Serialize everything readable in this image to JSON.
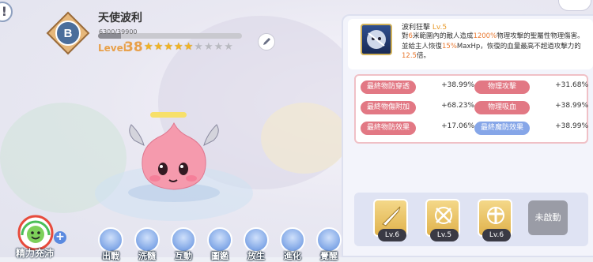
{
  "pet": {
    "rank": "B",
    "name": "天使波利",
    "exp_text": "6300/39900",
    "exp_fraction": 0.16,
    "level_label": "Level",
    "level_value": "38",
    "stars_filled": 5,
    "stars_total": 9
  },
  "skill": {
    "name": "波利狂擊",
    "level": "Lv.5",
    "desc_1": "對",
    "desc_2": "6",
    "desc_3": "米範圍內的敵人造成",
    "desc_4": "1200%",
    "desc_5": "物理攻擊的聖屬性物理傷害。並給主人恢復",
    "desc_6": "15%",
    "desc_7": "MaxHp，恢復的血量最高不超過攻擊力的",
    "desc_8": "12.5",
    "desc_9": "倍。"
  },
  "stats": [
    {
      "label": "最終物防穿透",
      "value": "+38.99%"
    },
    {
      "label": "最終物傷附加",
      "value": "+68.23%"
    },
    {
      "label": "最終物防效果",
      "value": "+17.06%"
    },
    {
      "label": "物理攻擊",
      "value": "+31.68%"
    },
    {
      "label": "物理吸血",
      "value": "+38.99%"
    },
    {
      "label": "最終魔防效果",
      "value": "+38.99%"
    }
  ],
  "skill_slots": [
    {
      "level": "Lv.6"
    },
    {
      "level": "Lv.5"
    },
    {
      "level": "Lv.6"
    }
  ],
  "inactive_label": "未啟動",
  "energy_label": "精力充沛",
  "bottom_menu": [
    "出戰",
    "洗髓",
    "互動",
    "圖鑑",
    "放生",
    "進化",
    "覺醒"
  ],
  "colors": {
    "accent_pink": "#e27884",
    "accent_blue": "#86a6e8",
    "level_orange": "#e8a04a",
    "star_gold": "#f0b524"
  }
}
